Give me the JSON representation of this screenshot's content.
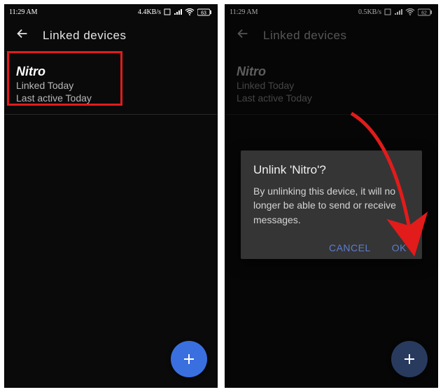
{
  "status": {
    "time": "11:29 AM",
    "net_left": "4.4KB/s",
    "net_right": "0.5KB/s",
    "batt_left": "63",
    "batt_right": "62"
  },
  "appbar": {
    "title": "Linked devices"
  },
  "device": {
    "name": "Nitro",
    "linked": "Linked Today",
    "active": "Last active Today"
  },
  "dialog": {
    "title": "Unlink 'Nitro'?",
    "body": "By unlinking this device, it will no longer be able to send or receive messages.",
    "cancel": "CANCEL",
    "ok": "OK"
  }
}
